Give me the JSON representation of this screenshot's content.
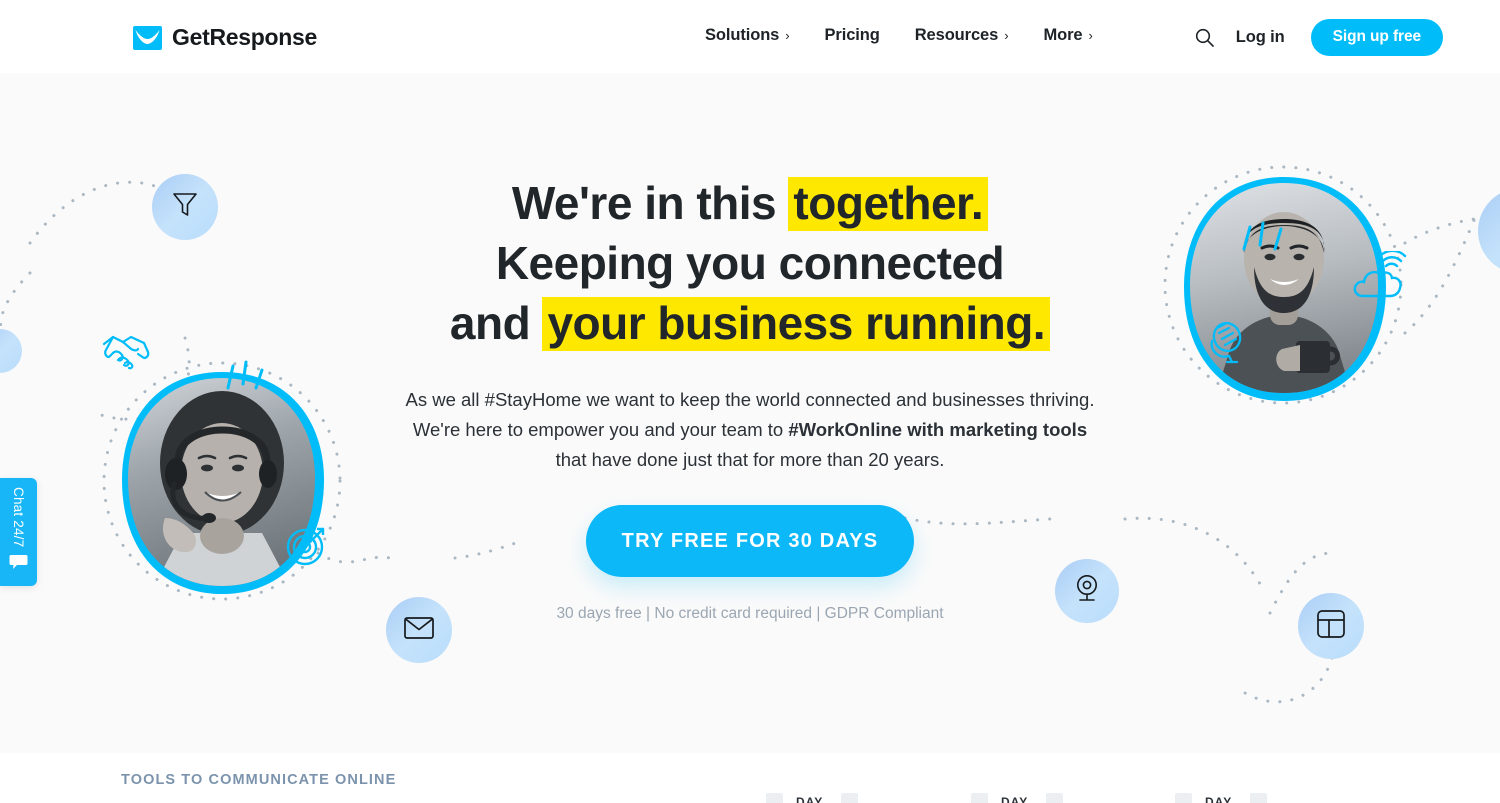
{
  "header": {
    "logo": {
      "text": "GetResponse",
      "icon": "envelope-logo-icon",
      "color": "#00bdfa"
    },
    "nav": [
      {
        "label": "Solutions",
        "caret": "›",
        "has_caret": true
      },
      {
        "label": "Pricing",
        "caret": "",
        "has_caret": false
      },
      {
        "label": "Resources",
        "caret": "›",
        "has_caret": true
      },
      {
        "label": "More",
        "caret": "›",
        "has_caret": true
      }
    ],
    "search_icon": "search-icon",
    "login_label": "Log in",
    "signup_label": "Sign up free",
    "signup_color": "#00bdfa"
  },
  "hero": {
    "headline": {
      "line1_pre": "We're in this ",
      "line1_hl": "together.",
      "line2": "Keeping you connected",
      "line3_pre": "and ",
      "line3_hl": "your business running.",
      "highlight_color": "#ffe800"
    },
    "subtitle": {
      "line1": "As we all #StayHome we want to keep the world connected and businesses thriving.",
      "line2_pre": "We're here to empower you and your team to ",
      "line2_bold": "#WorkOnline with marketing tools",
      "line3": "that have done just that for more than 20 years."
    },
    "cta": {
      "label": "TRY FREE FOR 30 DAYS",
      "color": "#0cb8f7",
      "note": "30 days free | No credit card required | GDPR Compliant"
    },
    "feature_circles": [
      {
        "name": "funnel-icon",
        "label": "Funnel"
      },
      {
        "name": "envelope-icon",
        "label": "Email"
      },
      {
        "name": "webcam-icon",
        "label": "Webcam"
      },
      {
        "name": "landing-page-icon",
        "label": "Landing page"
      },
      {
        "name": "partial-circle-left",
        "label": ""
      },
      {
        "name": "partial-circle-right",
        "label": ""
      }
    ],
    "accent_icons": [
      {
        "name": "handshake-icon",
        "color": "#00bdfa"
      },
      {
        "name": "target-icon",
        "color": "#00bdfa"
      },
      {
        "name": "microphone-icon",
        "color": "#00bdfa"
      },
      {
        "name": "cloud-wifi-icon",
        "color": "#00bdfa"
      }
    ],
    "photos": [
      {
        "name": "woman-headset-photo",
        "alt": "Woman wearing headset"
      },
      {
        "name": "man-coffee-photo",
        "alt": "Man holding coffee mug"
      }
    ]
  },
  "chat_widget": {
    "label": "Chat 24/7",
    "icon": "speech-bubble-icon",
    "color": "#18b6f6"
  },
  "bottom_section": {
    "eyebrow": "TOOLS TO COMMUNICATE ONLINE",
    "day_labels": [
      "DAY",
      "DAY",
      "DAY"
    ]
  }
}
